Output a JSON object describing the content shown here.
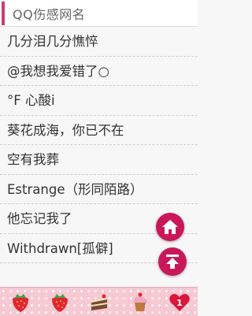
{
  "header": {
    "title": "QQ伤感网名"
  },
  "list": {
    "items": [
      "几分泪几分憔悴",
      "@我想我爱错了○",
      "°F 心酸i",
      "葵花成海，你已不在",
      "空有我葬",
      "Estrange（形同陌路）",
      "他忘记我了",
      "Withdrawn[孤僻]"
    ]
  },
  "colors": {
    "accent": "#d03a6a",
    "fab": "#c9185a",
    "bottom_bar": "#f6c9d3"
  },
  "icons": {
    "fab_home": "home-icon",
    "fab_top": "scroll-to-top-icon",
    "bottom_bar": [
      "strawberry-icon",
      "strawberry-icon",
      "cake-icon",
      "cupcake-icon",
      "heart-icon"
    ]
  },
  "badges": {
    "heart": "1"
  }
}
